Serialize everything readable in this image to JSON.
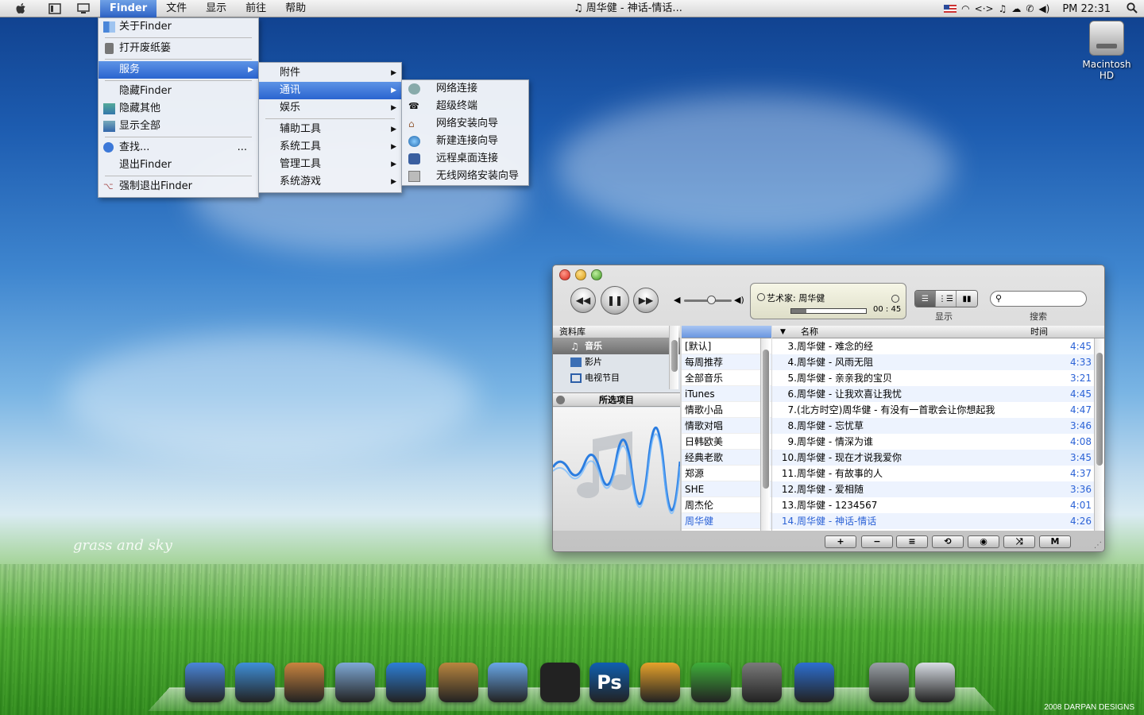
{
  "menubar": {
    "apple_icon": "apple-icon",
    "app_name": "Finder",
    "menus": [
      "文件",
      "显示",
      "前往",
      "帮助"
    ],
    "now_playing": "♫ 周华健 - 神话-情话...",
    "clock": "PM 22:31",
    "status_icons": [
      "flag-us-icon",
      "wifi-icon",
      "sync-icon",
      "music-icon",
      "weather-icon",
      "phone-icon",
      "volume-icon",
      "spotlight-icon"
    ]
  },
  "finder_menu": {
    "items": [
      {
        "label": "关于Finder",
        "icon": "finder-icon"
      },
      {
        "label": "打开废纸篓",
        "icon": "trash-icon"
      },
      {
        "label": "服务",
        "selected": true,
        "submenu": true
      },
      {
        "label": "隐藏Finder"
      },
      {
        "label": "隐藏其他",
        "icon": "hide-others-icon"
      },
      {
        "label": "显示全部",
        "icon": "show-all-icon"
      },
      {
        "label": "查找...",
        "icon": "search-icon",
        "ellipsis": "..."
      },
      {
        "label": "退出Finder"
      },
      {
        "label": "强制退出Finder",
        "icon": "force-quit-icon"
      }
    ]
  },
  "services_menu": {
    "items": [
      {
        "label": "附件"
      },
      {
        "label": "通讯",
        "selected": true
      },
      {
        "label": "娱乐"
      },
      {
        "label": "辅助工具"
      },
      {
        "label": "系统工具"
      },
      {
        "label": "管理工具"
      },
      {
        "label": "系统游戏"
      }
    ]
  },
  "comm_menu": {
    "items": [
      {
        "label": "网络连接",
        "icon": "network-icon"
      },
      {
        "label": "超级终端",
        "icon": "phone-icon"
      },
      {
        "label": "网络安装向导",
        "icon": "home-network-icon"
      },
      {
        "label": "新建连接向导",
        "icon": "globe-icon"
      },
      {
        "label": "远程桌面连接",
        "icon": "remote-desktop-icon"
      },
      {
        "label": "无线网络安装向导",
        "icon": "wireless-icon"
      }
    ]
  },
  "desktop": {
    "disk_label": "Macintosh HD",
    "signature": "grass and sky",
    "credits": "2008  DARPAN DESIGNS"
  },
  "itunes": {
    "lcd_artist": "艺术家: 周华健",
    "lcd_time": "00 : 45",
    "view_label": "显示",
    "search_label": "搜索",
    "search_placeholder": "",
    "source_header": "资料库",
    "sources": [
      "音乐",
      "影片",
      "电视节目"
    ],
    "selected_items_header": "所选项目",
    "genre_header": "",
    "genres": [
      "[默认]",
      "每周推荐",
      "全部音乐",
      "iTunes",
      "情歌小品",
      "情歌对唱",
      "日韩欧美",
      "经典老歌",
      "郑源",
      "SHE",
      "周杰伦",
      "周华健"
    ],
    "col_name": "名称",
    "col_time": "时间",
    "songs": [
      {
        "num": "3.",
        "title": "周华健 - 难念的经",
        "time": "4:45"
      },
      {
        "num": "4.",
        "title": "周华健 - 风雨无阻",
        "time": "4:33"
      },
      {
        "num": "5.",
        "title": "周华健 - 亲亲我的宝贝",
        "time": "3:21"
      },
      {
        "num": "6.",
        "title": "周华健 - 让我欢喜让我忧",
        "time": "4:45"
      },
      {
        "num": "7.",
        "title": "(北方时空)周华健 - 有没有一首歌会让你想起我",
        "time": "4:47"
      },
      {
        "num": "8.",
        "title": "周华健 - 忘忧草",
        "time": "3:46"
      },
      {
        "num": "9.",
        "title": "周华健 - 情深为谁",
        "time": "4:08"
      },
      {
        "num": "10.",
        "title": "周华健 - 现在才说我爱你",
        "time": "3:45"
      },
      {
        "num": "11.",
        "title": "周华健 - 有故事的人",
        "time": "4:37"
      },
      {
        "num": "12.",
        "title": "周华健 - 爱相随",
        "time": "3:36"
      },
      {
        "num": "13.",
        "title": "周华健 - 1234567",
        "time": "4:01"
      },
      {
        "num": "14.",
        "title": "周华健 - 神话-情话",
        "time": "4:26"
      }
    ],
    "bottom_buttons": [
      "add-playlist-button",
      "remove-button",
      "list-button",
      "repeat-button",
      "visualizer-button",
      "shuffle-button",
      "mini-button"
    ],
    "bottom_glyphs": [
      "+",
      "−",
      "≡",
      "⟲",
      "◉",
      "⤨",
      "M"
    ]
  },
  "dock": {
    "items": [
      {
        "name": "finder-icon",
        "color": "#4a86d9"
      },
      {
        "name": "safari-icon",
        "color": "#3f8fd8"
      },
      {
        "name": "iphoto-icon",
        "color": "#c9843f"
      },
      {
        "name": "folder-icon",
        "color": "#7fa9d6"
      },
      {
        "name": "quicktime-icon",
        "color": "#2d7fd6"
      },
      {
        "name": "address-book-icon",
        "color": "#b9863f"
      },
      {
        "name": "itunes-icon",
        "color": "#69a7e8"
      },
      {
        "name": "qq-icon",
        "color": "#222222"
      },
      {
        "name": "photoshop-icon",
        "color": "#0f5fb0",
        "glyph": "Ps"
      },
      {
        "name": "office-icon",
        "color": "#e6a22b"
      },
      {
        "name": "download-icon",
        "color": "#3fae3a"
      },
      {
        "name": "system-preferences-icon",
        "color": "#7a7a7a"
      },
      {
        "name": "media-player-icon",
        "color": "#2d6fd0"
      },
      {
        "name": "trash-icon",
        "color": "#9aa0a6"
      },
      {
        "name": "windows-icon",
        "color": "#d8dde4"
      }
    ]
  }
}
